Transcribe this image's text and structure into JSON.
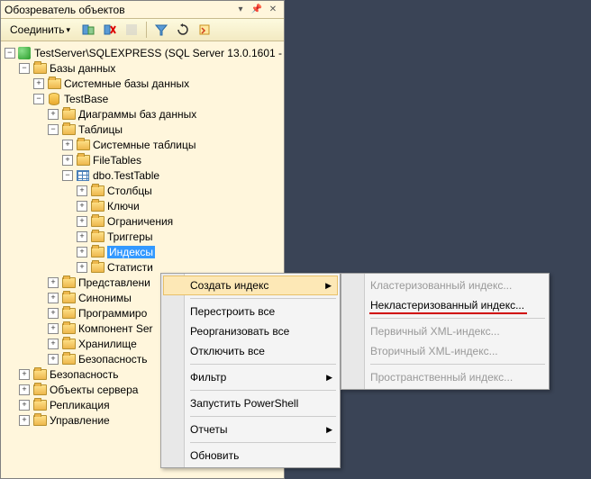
{
  "panel": {
    "title": "Обозреватель объектов"
  },
  "toolbar": {
    "connect_label": "Соединить"
  },
  "tree": {
    "server": "TestServer\\SQLEXPRESS (SQL Server 13.0.1601 -",
    "databases": "Базы данных",
    "sys_databases": "Системные базы данных",
    "testbase": "TestBase",
    "db_diagrams": "Диаграммы баз данных",
    "tables": "Таблицы",
    "sys_tables": "Системные таблицы",
    "file_tables": "FileTables",
    "test_table": "dbo.TestTable",
    "columns": "Столбцы",
    "keys": "Ключи",
    "constraints": "Ограничения",
    "triggers": "Триггеры",
    "indexes": "Индексы",
    "statistics": "Статисти",
    "views": "Представлени",
    "synonyms": "Синонимы",
    "programmability": "Программиро",
    "service_broker": "Компонент Ser",
    "storage": "Хранилище",
    "security_db": "Безопасность",
    "security": "Безопасность",
    "server_objects": "Объекты сервера",
    "replication": "Репликация",
    "management": "Управление"
  },
  "menu": {
    "create_index": "Создать индекс",
    "rebuild_all": "Перестроить все",
    "reorganize_all": "Реорганизовать все",
    "disable_all": "Отключить все",
    "filter": "Фильтр",
    "start_powershell": "Запустить PowerShell",
    "reports": "Отчеты",
    "refresh": "Обновить"
  },
  "submenu": {
    "clustered": "Кластеризованный индекс...",
    "nonclustered": "Некластеризованный индекс...",
    "primary_xml": "Первичный XML-индекс...",
    "secondary_xml": "Вторичный XML-индекс...",
    "spatial": "Пространственный индекс..."
  }
}
